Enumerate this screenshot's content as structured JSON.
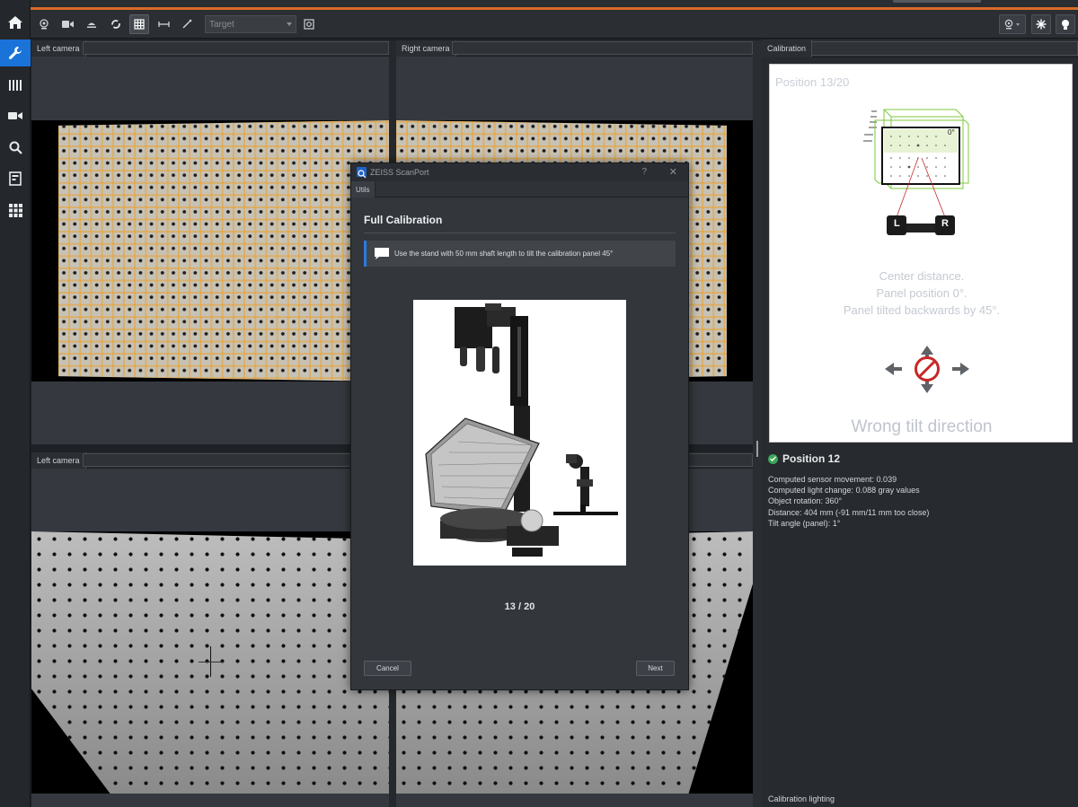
{
  "toolbar": {
    "target_placeholder": "Target",
    "icons": [
      "webcam-icon",
      "video-camera-icon",
      "turntable-icon",
      "refresh-icon",
      "grid-icon",
      "measure-icon",
      "wand-icon",
      "snapshot-icon",
      "camera-settings-icon",
      "brightness-icon",
      "bulb-icon"
    ]
  },
  "side_nav": {
    "items": [
      "home-icon",
      "wrench-icon",
      "barcode-icon",
      "video-camera-icon",
      "search-icon",
      "document-icon",
      "apps-grid-icon"
    ],
    "active": "wrench-icon"
  },
  "panels": {
    "top_left": {
      "title": "Left camera"
    },
    "top_right": {
      "title": "Right camera"
    },
    "bottom_left": {
      "title": "Left camera"
    },
    "calibration": {
      "title": "Calibration"
    }
  },
  "calibration": {
    "position_label": "Position 13/20",
    "tilt_label": "0°",
    "camera_left": "L",
    "camera_right": "R",
    "instructions": [
      "Center distance.",
      "Panel position 0°.",
      "Panel tilted backwards by 45°."
    ],
    "warning": "Wrong tilt direction",
    "status_title": "Position 12",
    "info": [
      "Computed sensor movement: 0.039",
      "Computed light change: 0.088 gray values",
      "Object rotation: 360°",
      "Distance: 404 mm (-91 mm/11 mm too close)",
      "Tilt angle (panel): 1°"
    ],
    "footer": "Calibration lighting",
    "colors": {
      "ok": "#3aa657",
      "forbidden": "#c62828",
      "frame_green": "#7cc83c"
    }
  },
  "dialog": {
    "title": "ZEISS ScanPort",
    "help": "?",
    "close": "✕",
    "tab": "Utils",
    "heading": "Full Calibration",
    "message": "Use the stand with 50 mm shaft length to tilt the calibration panel 45°",
    "counter": "13 / 20",
    "cancel_label": "Cancel",
    "next_label": "Next",
    "accent": "#2a7ae2"
  }
}
